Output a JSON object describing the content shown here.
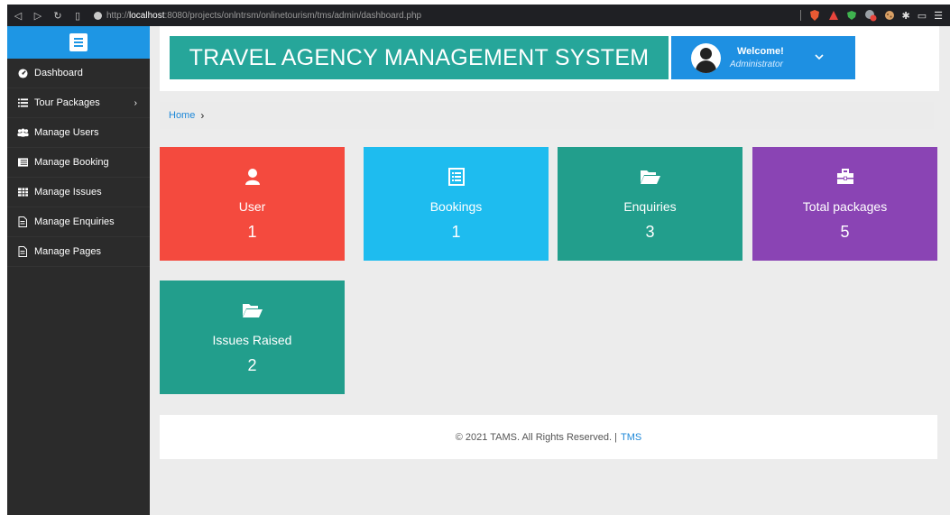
{
  "browser": {
    "url_prefix": "http://",
    "url_host": "localhost",
    "url_rest": ":8080/projects/onlntrsm/onlinetourism/tms/admin/dashboard.php"
  },
  "sidebar": {
    "items": [
      {
        "label": "Dashboard",
        "icon": "dashboard-icon"
      },
      {
        "label": "Tour Packages",
        "icon": "list-icon"
      },
      {
        "label": "Manage Users",
        "icon": "users-icon"
      },
      {
        "label": "Manage Booking",
        "icon": "list-icon"
      },
      {
        "label": "Manage Issues",
        "icon": "table-icon"
      },
      {
        "label": "Manage Enquiries",
        "icon": "file-icon"
      },
      {
        "label": "Manage Pages",
        "icon": "file-icon"
      }
    ]
  },
  "header": {
    "title": "TRAVEL AGENCY MANAGEMENT SYSTEM",
    "welcome": "Welcome!",
    "role": "Administrator"
  },
  "breadcrumb": {
    "home": "Home",
    "separator": "›"
  },
  "tiles": [
    {
      "label": "User",
      "value": "1",
      "color": "#f44a3e",
      "icon": "user-icon"
    },
    {
      "label": "Bookings",
      "value": "1",
      "color": "#1ebcef",
      "icon": "list-alt-icon"
    },
    {
      "label": "Enquiries",
      "value": "3",
      "color": "#229e8c",
      "icon": "folder-open-icon"
    },
    {
      "label": "Total packages",
      "value": "5",
      "color": "#8a44b4",
      "icon": "briefcase-icon"
    },
    {
      "label": "Issues Raised",
      "value": "2",
      "color": "#229e8c",
      "icon": "folder-open-icon"
    }
  ],
  "footer": {
    "text": "© 2021 TAMS. All Rights Reserved. |",
    "link": "TMS"
  }
}
